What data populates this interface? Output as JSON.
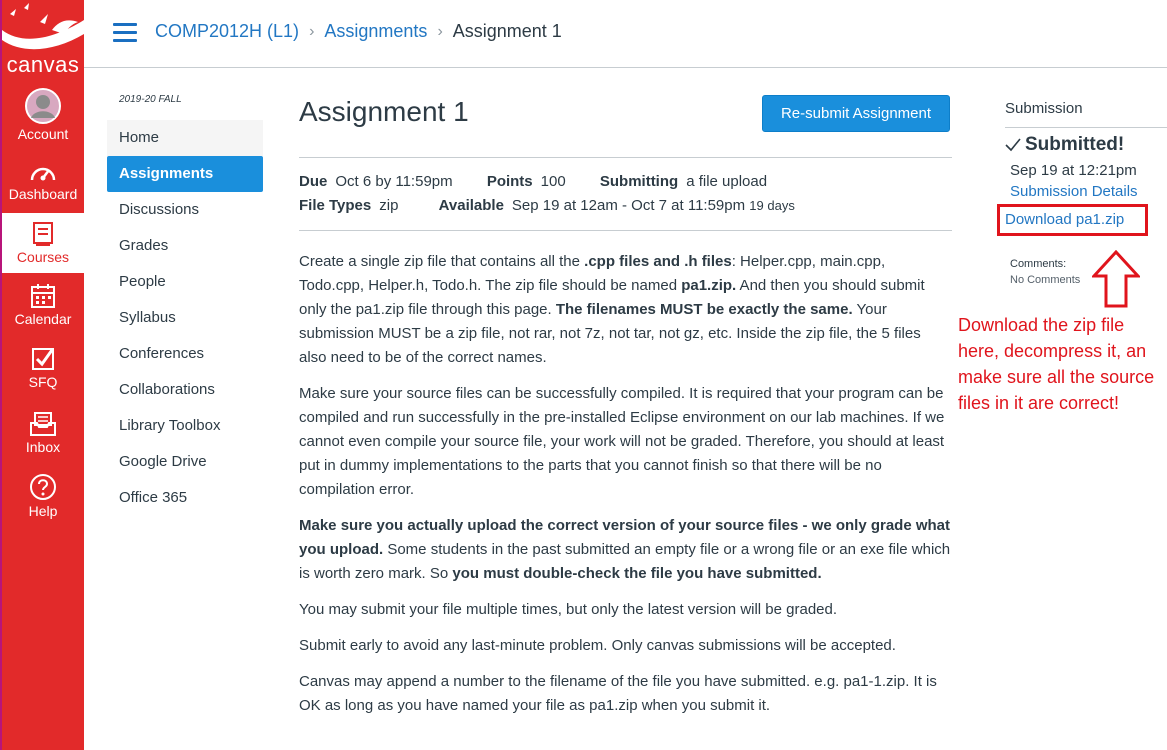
{
  "global_nav": {
    "logo_text": "canvas",
    "items": [
      {
        "label": "Account",
        "icon": "avatar-icon"
      },
      {
        "label": "Dashboard",
        "icon": "dashboard-icon"
      },
      {
        "label": "Courses",
        "icon": "courses-icon"
      },
      {
        "label": "Calendar",
        "icon": "calendar-icon"
      },
      {
        "label": "SFQ",
        "icon": "sfq-icon"
      },
      {
        "label": "Inbox",
        "icon": "inbox-icon"
      },
      {
        "label": "Help",
        "icon": "help-icon"
      }
    ],
    "colors": {
      "background": "#e22a2a",
      "active_text": "#e22a2a"
    }
  },
  "breadcrumbs": {
    "course": "COMP2012H (L1)",
    "section": "Assignments",
    "current": "Assignment 1"
  },
  "course_nav": {
    "term": "2019-20 FALL",
    "items": [
      "Home",
      "Assignments",
      "Discussions",
      "Grades",
      "People",
      "Syllabus",
      "Conferences",
      "Collaborations",
      "Library Toolbox",
      "Google Drive",
      "Office 365"
    ],
    "active": "Assignments"
  },
  "assignment": {
    "title": "Assignment 1",
    "resubmit_label": "Re-submit Assignment",
    "due_label": "Due",
    "due_value": "Oct 6 by 11:59pm",
    "points_label": "Points",
    "points_value": "100",
    "submitting_label": "Submitting",
    "submitting_value": "a file upload",
    "file_types_label": "File Types",
    "file_types_value": "zip",
    "available_label": "Available",
    "available_value": "Sep 19 at 12am - Oct 7 at 11:59pm",
    "available_days": "19 days",
    "p1": {
      "a": "Create a single zip file that contains all the ",
      "b": ".cpp files and .h files",
      "c": ": Helper.cpp, main.cpp, Todo.cpp, Helper.h, Todo.h. The zip file should be named ",
      "d": "pa1.zip.",
      "e": " And then you should submit only the pa1.zip file through this page. ",
      "f": "The filenames MUST be exactly the same.",
      "g": " Your submission MUST be a zip file, not rar, not 7z, not tar, not gz, etc. Inside the zip file, the 5 files also need to be of the correct names."
    },
    "p2": "Make sure your source files can be successfully compiled. It is required that your program can be compiled and run successfully in the pre-installed Eclipse environment on our lab machines. If we cannot even compile your source file, your work will not be graded. Therefore, you should at least put in dummy implementations to the parts that you cannot finish so that there will be no compilation error.",
    "p3": {
      "a": "Make sure you actually upload the correct version of your source files - we only grade what you upload.",
      "b": " Some students in the past submitted an empty file or a wrong file or an exe file which is worth zero mark. So ",
      "c": "you must double-check the file you have submitted."
    },
    "p4": "You may submit your file multiple times, but only the latest version will be graded.",
    "p5": "Submit early to avoid any last-minute problem. Only canvas submissions will be accepted.",
    "p6": "Canvas may append a number to the filename of the file you have submitted. e.g. pa1-1.zip. It is OK as long as you have named your file as pa1.zip when you submit it."
  },
  "submission": {
    "heading": "Submission",
    "status": "Submitted!",
    "time": "Sep 19 at 12:21pm",
    "details_link": "Submission Details",
    "download_link": "Download pa1.zip",
    "comments_label": "Comments:",
    "comments_value": "No Comments"
  },
  "annotation": {
    "text": "Download the zip file here, decompress it, an make sure all the source files in it are correct!",
    "color": "#e0141c"
  }
}
